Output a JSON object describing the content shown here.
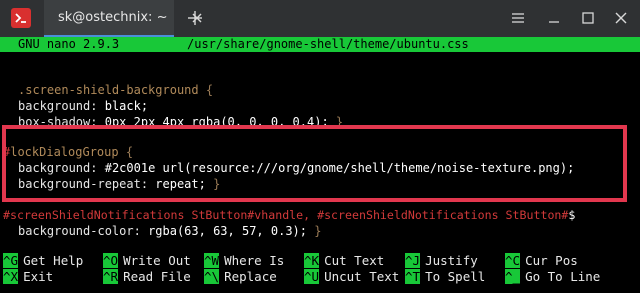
{
  "window": {
    "tab_title": "sk@ostechnix: ~",
    "icons": [
      "terminal-app-icon",
      "tab-close-icon",
      "new-tab-icon",
      "hamburger-menu-icon",
      "minimize-icon",
      "maximize-icon",
      "window-close-icon"
    ],
    "accent_color": "#4a90d9",
    "app_icon_color": "#d9302f"
  },
  "nano": {
    "version": "GNU nano 2.9.3",
    "file_path": "/usr/share/gnome-shell/theme/ubuntu.css",
    "header_color": "#18c838"
  },
  "code": {
    "l1_selector": ".screen-shield-background",
    "l1_brace": "{",
    "l2_prop": "background:",
    "l2_val": "black;",
    "l3_prop": "box-shadow:",
    "l3_val": "0px 2px 4px rgba(0, 0, 0, 0.4);",
    "l3_brace": "}",
    "l4_hash": "#",
    "l4_selector": "lockDialogGroup",
    "l4_brace": "{",
    "l5_prop": "background:",
    "l5_val": "#2c001e url(resource:///org/gnome/shell/theme/noise-texture.png);",
    "l6_prop": "background-repeat:",
    "l6_val": "repeat;",
    "l6_brace": "}",
    "l7_text": "#screenShieldNotifications StButton#vhandle, #screenShieldNotifications StButton#",
    "l7_overflow": "$",
    "l8_prop": "background-color:",
    "l8_val": "rgba(63, 63, 57, 0.3);",
    "l8_brace": "}"
  },
  "highlight": {
    "color": "#e2374e"
  },
  "shortcuts": [
    {
      "key": "^G",
      "label": "Get Help"
    },
    {
      "key": "^O",
      "label": "Write Out"
    },
    {
      "key": "^W",
      "label": "Where Is"
    },
    {
      "key": "^K",
      "label": "Cut Text"
    },
    {
      "key": "^J",
      "label": "Justify"
    },
    {
      "key": "^C",
      "label": "Cur Pos"
    },
    {
      "key": "^X",
      "label": "Exit"
    },
    {
      "key": "^R",
      "label": "Read File"
    },
    {
      "key": "^\\",
      "label": "Replace"
    },
    {
      "key": "^U",
      "label": "Uncut Text"
    },
    {
      "key": "^T",
      "label": "To Spell"
    },
    {
      "key": "^_",
      "label": "Go To Line"
    }
  ]
}
